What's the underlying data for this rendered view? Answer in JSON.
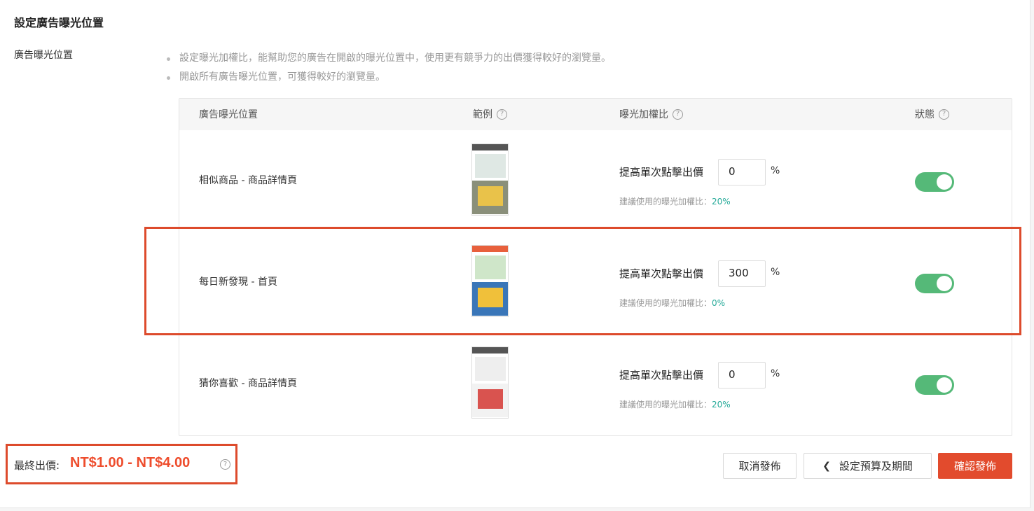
{
  "section": {
    "title": "設定廣告曝光位置"
  },
  "field": {
    "label": "廣告曝光位置",
    "notes": [
      "設定曝光加權比，能幫助您的廣告在開啟的曝光位置中，使用更有競爭力的出價獲得較好的瀏覽量。",
      "開啟所有廣告曝光位置，可獲得較好的瀏覽量。"
    ]
  },
  "table": {
    "headers": {
      "placement": "廣告曝光位置",
      "example": "範例",
      "weight": "曝光加權比",
      "status": "狀態"
    },
    "help_glyph": "?",
    "rows": [
      {
        "name": "相似商品 - 商品詳情頁",
        "bid_label": "提高單次點擊出價",
        "bid_value": "0",
        "unit": "%",
        "suggest_label": "建議使用的曝光加權比：",
        "suggest_value": "20%",
        "enabled": true
      },
      {
        "name": "每日新發現 - 首頁",
        "bid_label": "提高單次點擊出價",
        "bid_value": "300",
        "unit": "%",
        "suggest_label": "建議使用的曝光加權比：",
        "suggest_value": "0%",
        "enabled": true
      },
      {
        "name": "猜你喜歡 - 商品詳情頁",
        "bid_label": "提高單次點擊出價",
        "bid_value": "0",
        "unit": "%",
        "suggest_label": "建議使用的曝光加權比：",
        "suggest_value": "20%",
        "enabled": true
      }
    ]
  },
  "footer": {
    "price_label": "最終出價:",
    "price_value": "NT$1.00 - NT$4.00",
    "buttons": {
      "cancel": "取消發佈",
      "back": "設定預算及期間",
      "confirm": "確認發佈"
    }
  },
  "colors": {
    "accent": "#ee4d2d",
    "toggle_on": "#55b978",
    "suggest": "#26aa99",
    "highlight": "#dd4b2c"
  }
}
